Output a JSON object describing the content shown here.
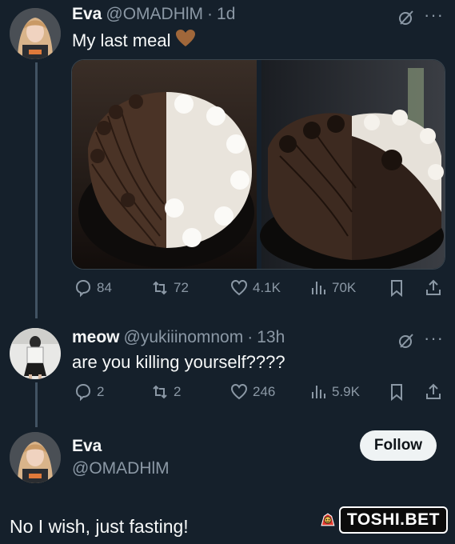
{
  "tweet1": {
    "name": "Eva",
    "handle": "@OMADHlM",
    "sep": "·",
    "time": "1d",
    "text": "My last meal",
    "emoji": "🤎",
    "replies": "84",
    "retweets": "72",
    "likes": "4.1K",
    "views": "70K"
  },
  "tweet2": {
    "name": "meow",
    "handle": "@yukiiinomnom",
    "sep": "·",
    "time": "13h",
    "text": "are you killing yourself????",
    "replies": "2",
    "retweets": "2",
    "likes": "246",
    "views": "5.9K"
  },
  "tweet3": {
    "name": "Eva",
    "handle": "@OMADHlM",
    "follow_label": "Follow",
    "text": "No I wish, just fasting!"
  },
  "watermark": {
    "text": "TOSHI.BET"
  },
  "colors": {
    "background": "#15202b",
    "text": "#f7f9f9",
    "muted": "#8b98a5",
    "thread_line": "#425363",
    "follow_bg": "#eff3f4"
  }
}
